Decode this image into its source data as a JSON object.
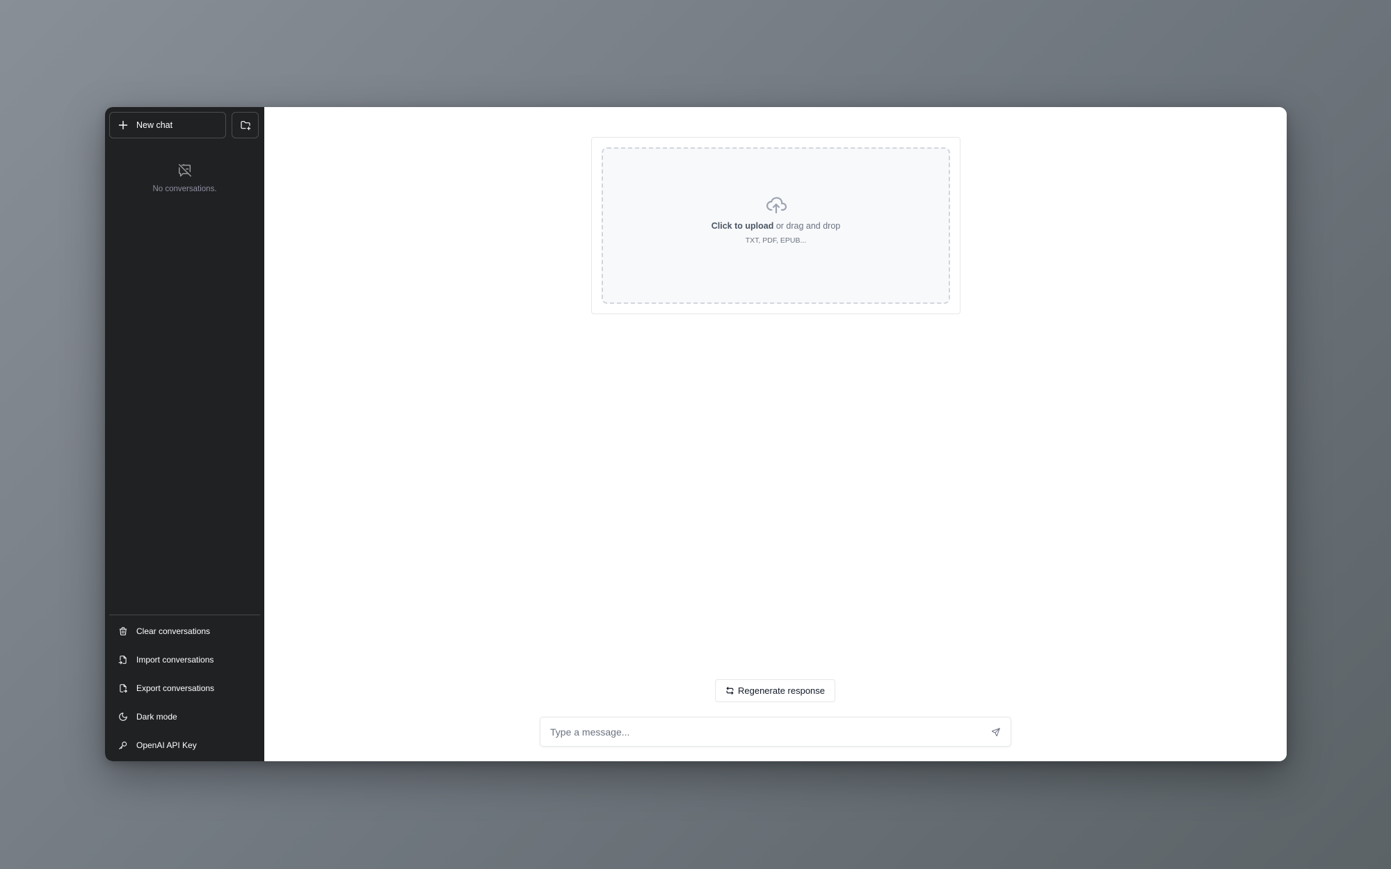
{
  "sidebar": {
    "new_chat_label": "New chat",
    "new_folder_icon": "folder-plus-icon",
    "empty_state": {
      "icon": "message-off-icon",
      "label": "No conversations."
    },
    "menu_items": [
      {
        "label": "Clear conversations",
        "icon": "trash-icon"
      },
      {
        "label": "Import conversations",
        "icon": "file-import-icon"
      },
      {
        "label": "Export conversations",
        "icon": "file-export-icon"
      },
      {
        "label": "Dark mode",
        "icon": "moon-icon"
      },
      {
        "label": "OpenAI API Key",
        "icon": "key-icon"
      }
    ]
  },
  "main": {
    "upload": {
      "icon": "cloud-upload-icon",
      "primary_bold": "Click to upload",
      "primary_rest": " or drag and drop",
      "secondary": "TXT, PDF, EPUB..."
    },
    "regenerate_label": "Regenerate response",
    "message_input": {
      "placeholder": "Type a message...",
      "value": ""
    }
  },
  "colors": {
    "sidebar_bg": "#202123",
    "main_bg": "#ffffff",
    "dropzone_bg": "#f8f9fb",
    "muted_text": "#6b7280"
  }
}
